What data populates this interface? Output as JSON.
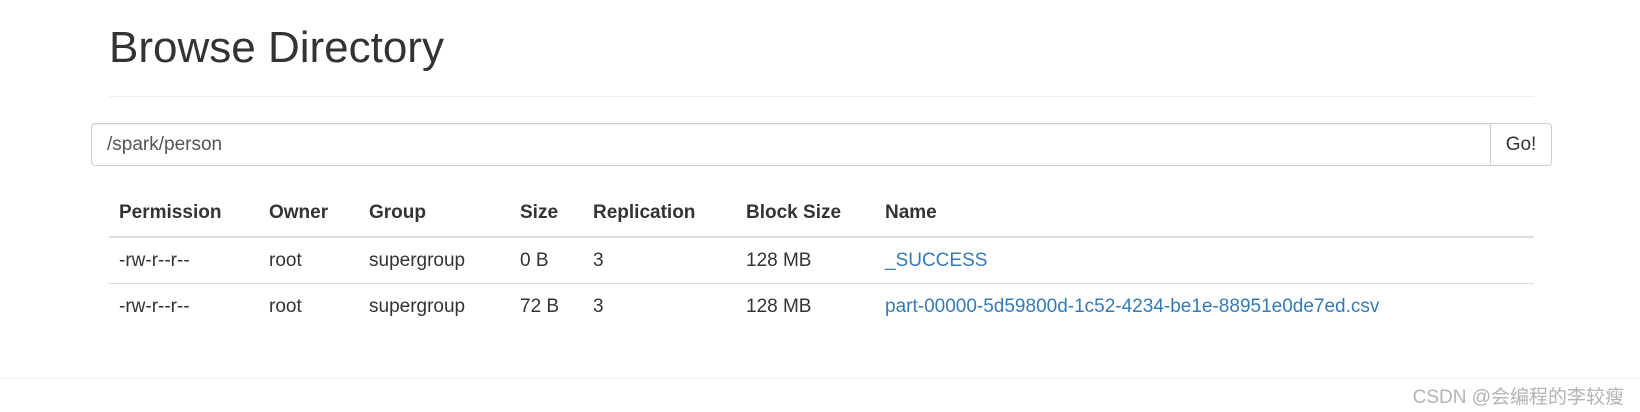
{
  "page": {
    "title": "Browse Directory"
  },
  "path_bar": {
    "value": "/spark/person",
    "go_label": "Go!"
  },
  "table": {
    "headers": {
      "permission": "Permission",
      "owner": "Owner",
      "group": "Group",
      "size": "Size",
      "replication": "Replication",
      "block_size": "Block Size",
      "name": "Name"
    },
    "rows": [
      {
        "permission": "-rw-r--r--",
        "owner": "root",
        "group": "supergroup",
        "size": "0 B",
        "replication": "3",
        "block_size": "128 MB",
        "name": "_SUCCESS"
      },
      {
        "permission": "-rw-r--r--",
        "owner": "root",
        "group": "supergroup",
        "size": "72 B",
        "replication": "3",
        "block_size": "128 MB",
        "name": "part-00000-5d59800d-1c52-4234-be1e-88951e0de7ed.csv"
      }
    ]
  },
  "watermark": {
    "text": "CSDN @会编程的李较瘦"
  },
  "colors": {
    "link": "#337ab7",
    "text": "#333333",
    "border": "#dddddd"
  }
}
